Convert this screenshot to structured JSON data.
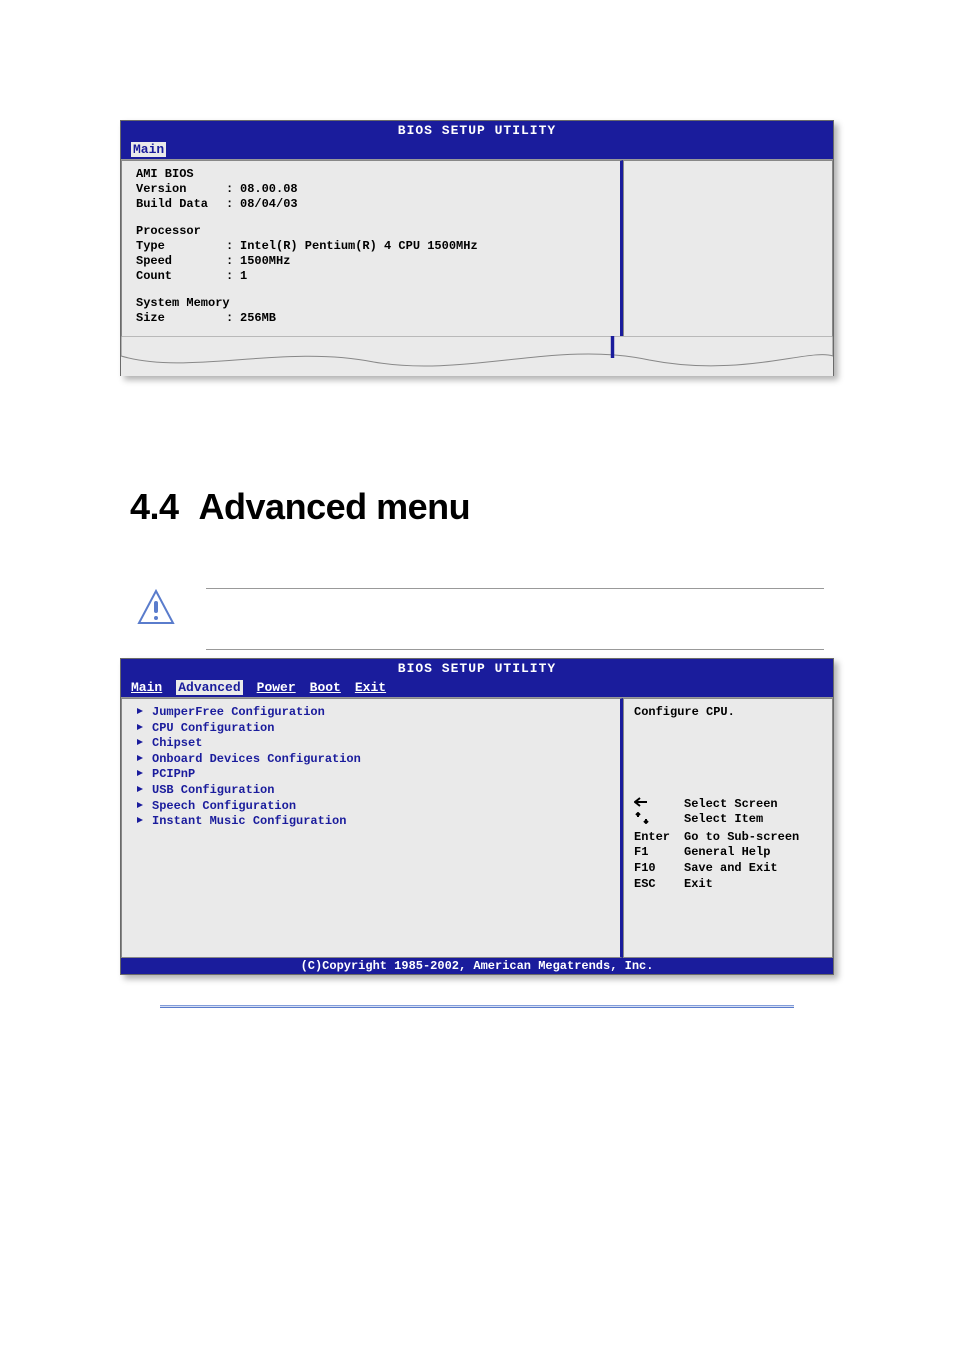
{
  "bios1": {
    "title": "BIOS SETUP UTILITY",
    "tab_main": "Main",
    "section_amibios": "AMI BIOS",
    "row_version_label": "Version",
    "row_version_value": "08.00.08",
    "row_builddata_label": "Build Data",
    "row_builddata_value": "08/04/03",
    "section_processor": "Processor",
    "row_type_label": "Type",
    "row_type_value": "Intel(R) Pentium(R) 4 CPU 1500MHz",
    "row_speed_label": "Speed",
    "row_speed_value": "1500MHz",
    "row_count_label": "Count",
    "row_count_value": "1",
    "section_sysmem": "System Memory",
    "row_size_label": "Size",
    "row_size_value": "256MB"
  },
  "heading": {
    "number": "4.4",
    "title": "Advanced menu"
  },
  "bios2": {
    "title": "BIOS SETUP UTILITY",
    "tabs": {
      "main": "Main",
      "advanced": "Advanced",
      "power": "Power",
      "boot": "Boot",
      "exit": "Exit"
    },
    "items": [
      "JumperFree Configuration",
      "CPU Configuration",
      "Chipset",
      "Onboard Devices Configuration",
      "PCIPnP",
      "USB Configuration",
      "Speech Configuration",
      "Instant Music Configuration"
    ],
    "side_help": "Configure CPU.",
    "nav": {
      "select_screen": "Select Screen",
      "select_item": "Select Item",
      "enter_key": "Enter",
      "enter_text": "Go to Sub-screen",
      "f1_key": "F1",
      "f1_text": "General Help",
      "f10_key": "F10",
      "f10_text": "Save and Exit",
      "esc_key": "ESC",
      "esc_text": "Exit"
    },
    "footer": "(C)Copyright 1985-2002, American Megatrends, Inc."
  }
}
